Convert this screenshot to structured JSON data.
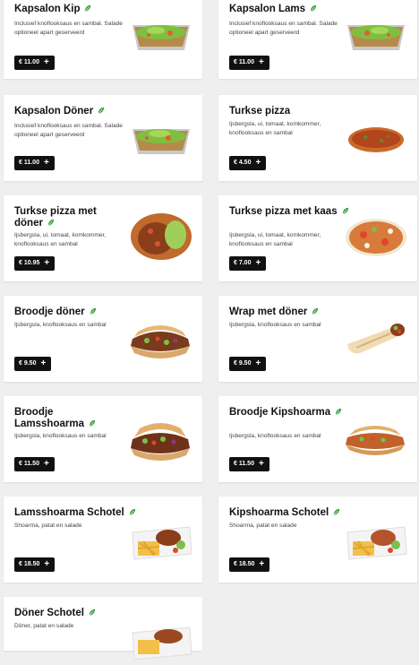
{
  "menu": {
    "items": [
      {
        "title": "Kapsalon Kip",
        "description": "Inclusief knoflooksaus en sambal. Salade optioneel apart geserveerd",
        "price": "€ 11.00"
      },
      {
        "title": "Kapsalon Lams",
        "description": "Inclusief knoflooksaus en sambal. Salade optioneel apart geserveerd",
        "price": "€ 11.00"
      },
      {
        "title": "Kapsalon Döner",
        "description": "Inclusief knoflooksaus en sambal. Salade optioneel apart geserveerd",
        "price": "€ 11.00"
      },
      {
        "title": "Turkse pizza",
        "description": "Ijsbergsla, ui, tomaat, komkommer, knoflooksaus en sambal",
        "price": "€ 4.50"
      },
      {
        "title": "Turkse pizza met döner",
        "description": "Ijsbergsla, ui, tomaat, komkommer, knoflooksaus en sambal",
        "price": "€ 10.95"
      },
      {
        "title": "Turkse pizza met kaas",
        "description": "Ijsbergsla, ui, tomaat, komkommer, knoflooksaus en sambal",
        "price": "€ 7.00"
      },
      {
        "title": "Broodje döner",
        "description": "Ijsbergsla, knoflooksaus en sambal",
        "price": "€ 9.50"
      },
      {
        "title": "Wrap met döner",
        "description": "Ijsbergsla, knoflooksaus en sambal",
        "price": "€ 9.50"
      },
      {
        "title": "Broodje Lamsshoarma",
        "description": "Ijsbergsla, knoflooksaus en sambal",
        "price": "€ 11.50"
      },
      {
        "title": "Broodje Kipshoarma",
        "description": "Ijsbergsla, knoflooksaus en sambal",
        "price": "€ 11.50"
      },
      {
        "title": "Lamsshoarma Schotel",
        "description": "Shoarma, patat en salade",
        "price": "€ 18.50"
      },
      {
        "title": "Kipshoarma Schotel",
        "description": "Shoarma, patat en salade",
        "price": "€ 18.50"
      },
      {
        "title": "Döner Schotel",
        "description": "Döner, patat en salade",
        "price": ""
      }
    ]
  },
  "icons": {
    "diet_icon": "vegetarian-leaf-icon",
    "add_icon": "plus-icon"
  },
  "colors": {
    "background": "#efefef",
    "card": "#ffffff",
    "price_button": "#111111",
    "diet_icon": "#2e9b2e"
  }
}
